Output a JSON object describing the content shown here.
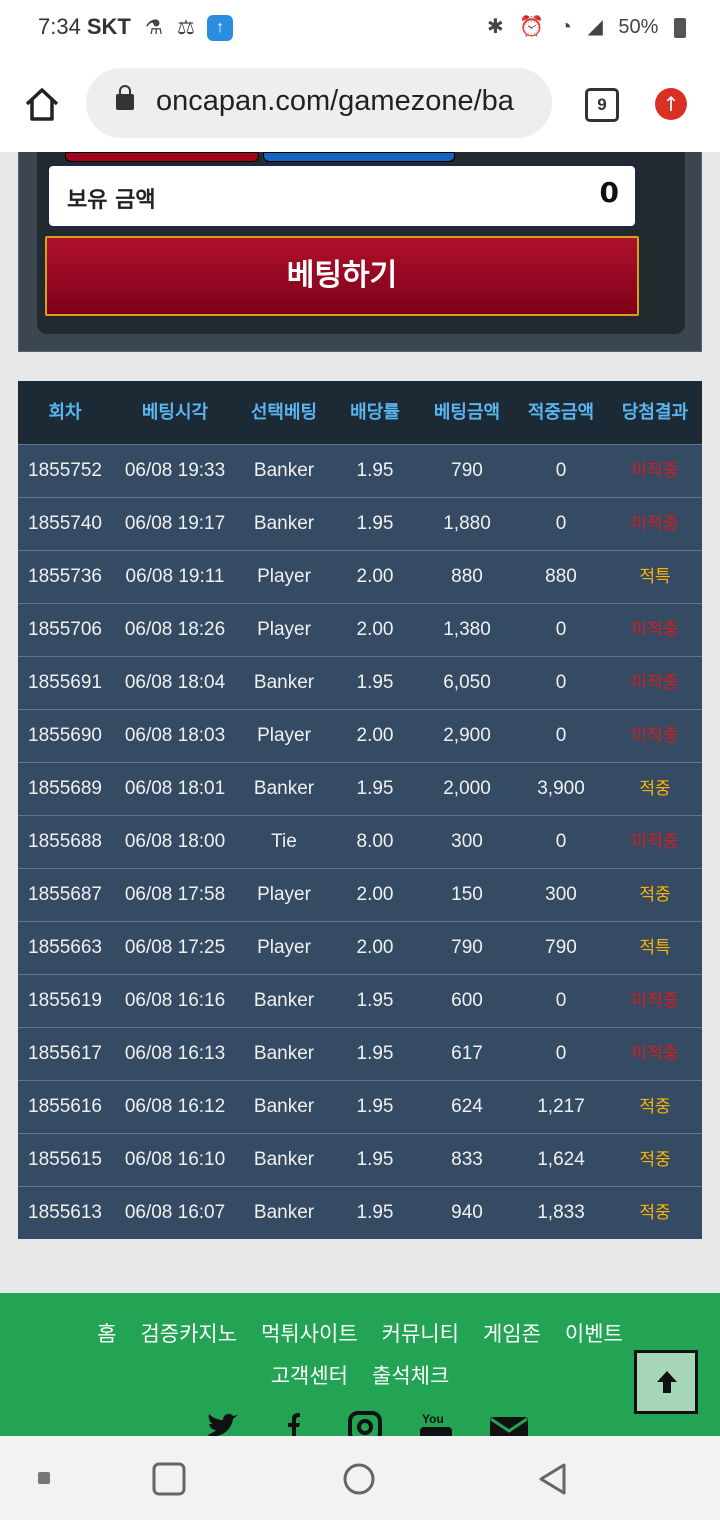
{
  "status_bar": {
    "time": "7:34",
    "carrier": "SKT",
    "battery": "50%"
  },
  "browser": {
    "url": "oncapan.com/gamezone/ba",
    "tab_count": "9"
  },
  "betting": {
    "balance_label": "보유 금액",
    "balance_value": "0",
    "bet_button": "베팅하기"
  },
  "table": {
    "headers": [
      "회차",
      "베팅시각",
      "선택베팅",
      "배당률",
      "베팅금액",
      "적중금액",
      "당첨결과"
    ],
    "rows": [
      {
        "round": "1855752",
        "time": "06/08 19:33",
        "pick": "Banker",
        "odds": "1.95",
        "amount": "790",
        "payout": "0",
        "result": "미적중"
      },
      {
        "round": "1855740",
        "time": "06/08 19:17",
        "pick": "Banker",
        "odds": "1.95",
        "amount": "1,880",
        "payout": "0",
        "result": "미적중"
      },
      {
        "round": "1855736",
        "time": "06/08 19:11",
        "pick": "Player",
        "odds": "2.00",
        "amount": "880",
        "payout": "880",
        "result": "적특"
      },
      {
        "round": "1855706",
        "time": "06/08 18:26",
        "pick": "Player",
        "odds": "2.00",
        "amount": "1,380",
        "payout": "0",
        "result": "미적중"
      },
      {
        "round": "1855691",
        "time": "06/08 18:04",
        "pick": "Banker",
        "odds": "1.95",
        "amount": "6,050",
        "payout": "0",
        "result": "미적중"
      },
      {
        "round": "1855690",
        "time": "06/08 18:03",
        "pick": "Player",
        "odds": "2.00",
        "amount": "2,900",
        "payout": "0",
        "result": "미적중"
      },
      {
        "round": "1855689",
        "time": "06/08 18:01",
        "pick": "Banker",
        "odds": "1.95",
        "amount": "2,000",
        "payout": "3,900",
        "result": "적중"
      },
      {
        "round": "1855688",
        "time": "06/08 18:00",
        "pick": "Tie",
        "odds": "8.00",
        "amount": "300",
        "payout": "0",
        "result": "미적중"
      },
      {
        "round": "1855687",
        "time": "06/08 17:58",
        "pick": "Player",
        "odds": "2.00",
        "amount": "150",
        "payout": "300",
        "result": "적중"
      },
      {
        "round": "1855663",
        "time": "06/08 17:25",
        "pick": "Player",
        "odds": "2.00",
        "amount": "790",
        "payout": "790",
        "result": "적특"
      },
      {
        "round": "1855619",
        "time": "06/08 16:16",
        "pick": "Banker",
        "odds": "1.95",
        "amount": "600",
        "payout": "0",
        "result": "미적중"
      },
      {
        "round": "1855617",
        "time": "06/08 16:13",
        "pick": "Banker",
        "odds": "1.95",
        "amount": "617",
        "payout": "0",
        "result": "미적중"
      },
      {
        "round": "1855616",
        "time": "06/08 16:12",
        "pick": "Banker",
        "odds": "1.95",
        "amount": "624",
        "payout": "1,217",
        "result": "적중"
      },
      {
        "round": "1855615",
        "time": "06/08 16:10",
        "pick": "Banker",
        "odds": "1.95",
        "amount": "833",
        "payout": "1,624",
        "result": "적중"
      },
      {
        "round": "1855613",
        "time": "06/08 16:07",
        "pick": "Banker",
        "odds": "1.95",
        "amount": "940",
        "payout": "1,833",
        "result": "적중"
      }
    ]
  },
  "footer": {
    "nav": [
      "홈",
      "검증카지노",
      "먹튀사이트",
      "커뮤니티",
      "게임존",
      "이벤트",
      "고객센터",
      "출석체크"
    ],
    "social": [
      "twitter-icon",
      "facebook-icon",
      "instagram-icon",
      "youtube-icon",
      "email-icon"
    ]
  },
  "colors": {
    "lose": "#d81b1b",
    "win": "#ffb300",
    "footer": "#23a455",
    "header_text": "#5ab4ee"
  }
}
